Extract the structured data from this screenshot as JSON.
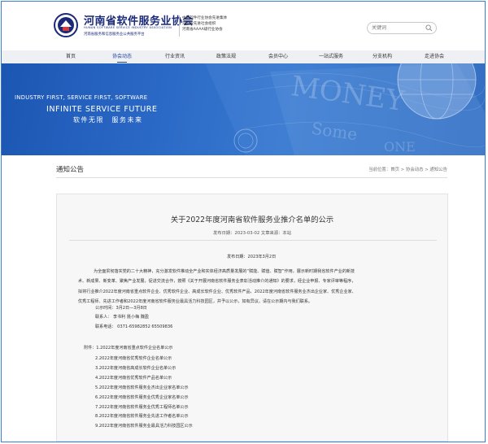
{
  "header": {
    "logo_cn": "河南省软件服务业协会",
    "logo_en": "HUNAN SOFTWARE SERVICE INDUSTRY ASSOCIATION",
    "logo_sub": "河南省服务和信息服务业公共服务平台",
    "honors": [
      "中国软件行业协会先进集体",
      "河南省先进社会组织",
      "河南省AAAA级行业协会"
    ],
    "search_placeholder": "关键词"
  },
  "nav": {
    "items": [
      "首页",
      "协会动态",
      "行业资讯",
      "政策法规",
      "会员中心",
      "一站式服务",
      "分支机构",
      "走进协会"
    ],
    "active_index": 1
  },
  "banner": {
    "slogan1": "INDUSTRY FIRST, SERVICE FIRST, SOFTWARE",
    "slogan2": "INFINITE SERVICE FUTURE",
    "slogan3": "软件无限　服务未来",
    "bg_text1": "MONEY",
    "bg_text2": "Some",
    "bg_text3": "ONE"
  },
  "section": {
    "title": "通知公告",
    "breadcrumb": "当前位置：首页 > 协会动态 > 通知公告"
  },
  "article": {
    "title": "关于2022年度河南省软件服务业推介名单的公示",
    "meta": "发布日期：2023-03-02  文章来源：本站",
    "publish_line": "发布日期：2023年3月2日",
    "body_lines": [
      "为全面贯彻落实党的二十大精神，充分激发软件推动全产业和实体经济高质量发展的“赋能、赋值、赋智”作用，展示新时期我省软件产业的新技",
      "术、新成果、新变革、聚焦产业发展，促进交流合作，按照《关于开展河南省软件服务业表彰活动推介的通知》的要求，经企业申报、专家评审等程序，",
      "拟将行业推介2022年度河南省重点软件企业、优秀软件企业、高成长软件企业、优秀软件产品、2022年度河南省软件服务业杰出企业家、优秀企业家、",
      "优秀工程师、先进工作者和2022年度河南省软件服务业最具活力科技园区，并予以公示，如有异议，请在公示期内与我们联系。"
    ],
    "contacts": [
      "公示时间：3月2日—3月8日",
      "联系人：  李书利  聂小梅  魏盈",
      "联系电话：  0371-65982852  65509836"
    ],
    "attachments_head": "附件：1.2022年度河南省重点软件企业名单公示",
    "attachments": [
      "2.2022年度河南省优秀软件企业名单公示",
      "3.2022年度河南省高成长软件企业名单公示",
      "4.2022年度河南省优秀软件产品名单公示",
      "5.2022年度河南省软件服务业杰出企业家名单公示",
      "6.2022年度河南省软件服务业优秀企业家名单公示",
      "7.2022年度河南省软件服务业优秀工程师名单公示",
      "8.2022年度河南省软件服务业先进工作者名单公示",
      "9.2022年度河南省软件服务业最具活力科技园区公示"
    ]
  },
  "colors": {
    "brand": "#1b2a78",
    "nav_active": "#1e46a0",
    "banner": "#2c6ac7"
  }
}
